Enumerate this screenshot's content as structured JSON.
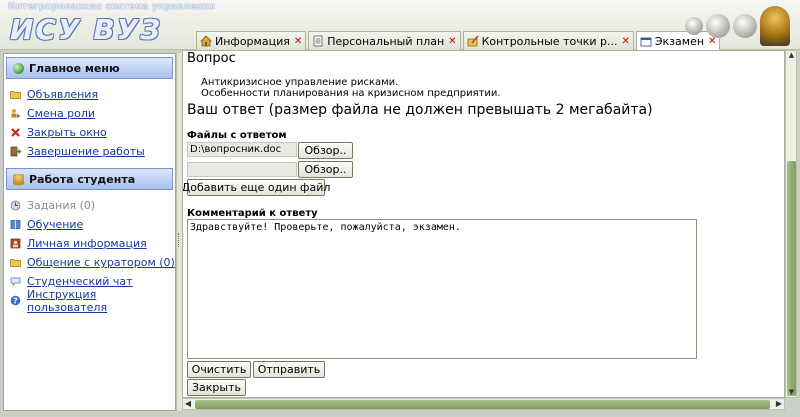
{
  "app": {
    "subtitle": "Интегрированная система управления",
    "title": "ИСУ ВУЗ"
  },
  "tabs": [
    {
      "label": "Информация",
      "icon": "home-icon",
      "active": false
    },
    {
      "label": "Персональный план",
      "icon": "document-icon",
      "active": false
    },
    {
      "label": "Контрольные точки р...",
      "icon": "pencil-icon",
      "active": false
    },
    {
      "label": "Экзамен",
      "icon": "window-icon",
      "active": true
    }
  ],
  "sidebar": {
    "main_menu": {
      "title": "Главное меню",
      "items": [
        {
          "label": "Объявления",
          "icon": "folder-icon"
        },
        {
          "label": "Смена роли",
          "icon": "user-switch-icon"
        },
        {
          "label": "Закрыть окно",
          "icon": "close-icon"
        },
        {
          "label": "Завершение работы",
          "icon": "exit-icon"
        }
      ]
    },
    "student_menu": {
      "title": "Работа студента",
      "items": [
        {
          "label": "Задания (0)",
          "icon": "task-icon",
          "disabled": true
        },
        {
          "label": "Обучение",
          "icon": "book-icon"
        },
        {
          "label": "Личная информация",
          "icon": "person-card-icon"
        },
        {
          "label": "Общение с куратором (0)",
          "icon": "folder-icon"
        },
        {
          "label": "Студенческий чат",
          "icon": "chat-icon"
        },
        {
          "label": "Инструкция пользователя",
          "icon": "help-icon"
        }
      ]
    }
  },
  "exam": {
    "question_title": "Вопрос",
    "question_lines": [
      "Антикризисное управление рисками.",
      "Особенности планирования на кризисном предприятии."
    ],
    "answer_title": "Ваш ответ (размер файла не должен превышать 2 мегабайта)",
    "files_title": "Файлы с ответом",
    "files": [
      {
        "value": "D:\\вопросник.doc"
      },
      {
        "value": ""
      }
    ],
    "browse_label": "Обзор..",
    "add_file_label": "Добавить еще один файл",
    "comment_title": "Комментарий к ответу",
    "comment_text": "Здравствуйте! Проверьте, пожалуйста, экзамен.",
    "clear_label": "Очистить",
    "send_label": "Отправить",
    "close_label": "Закрыть"
  }
}
